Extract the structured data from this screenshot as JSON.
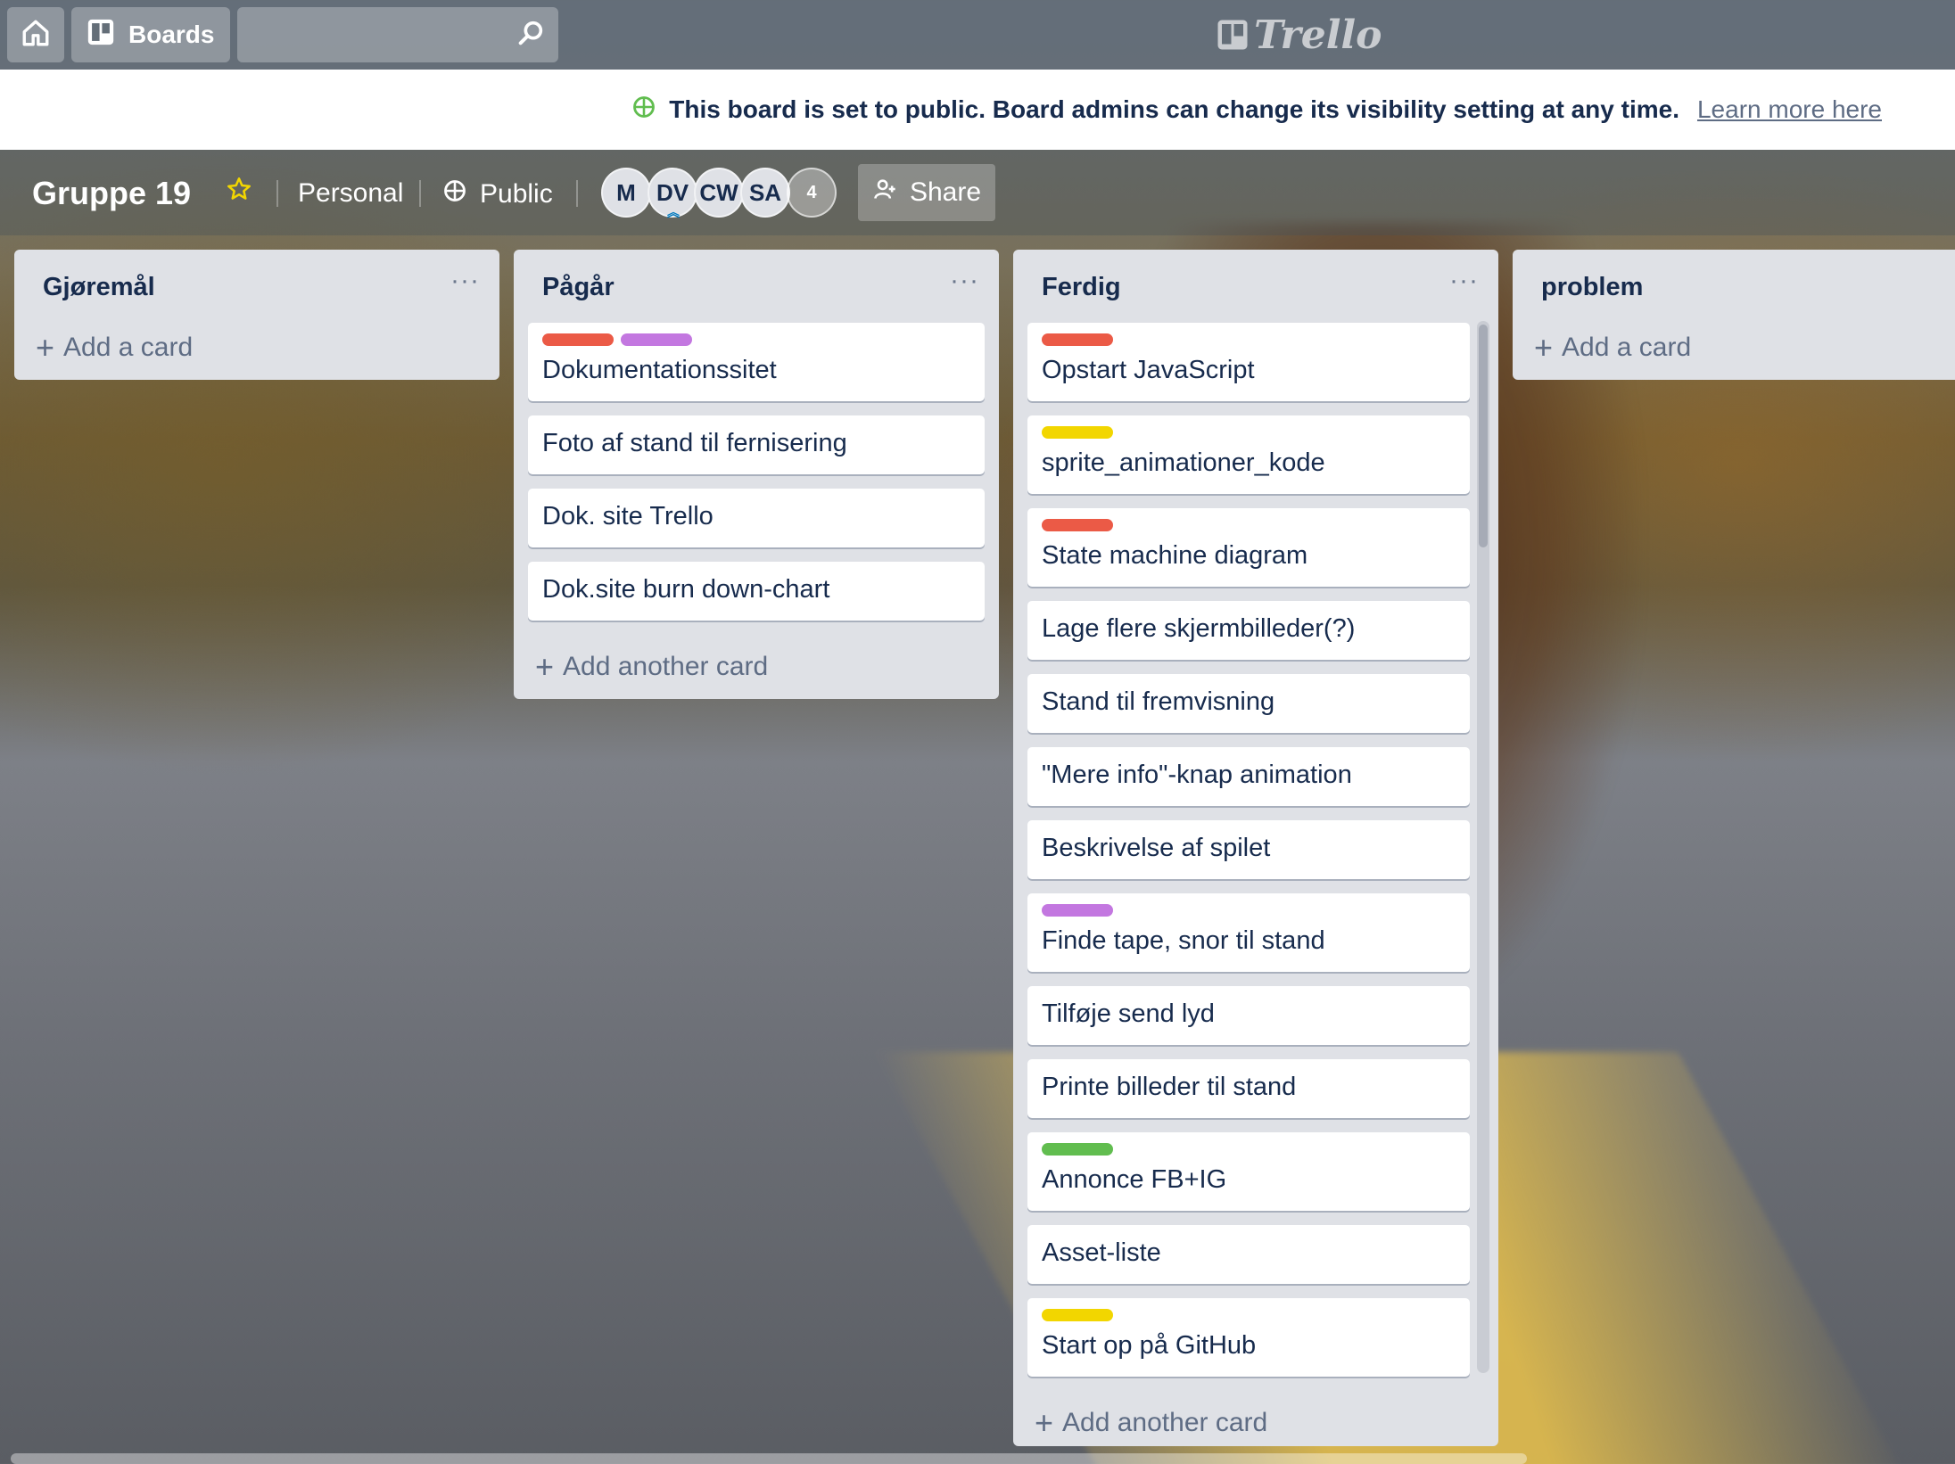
{
  "header": {
    "boards_label": "Boards",
    "logo_text": "Trello"
  },
  "notice": {
    "message": "This board is set to public. Board admins can change its visibility setting at any time.",
    "link": "Learn more here"
  },
  "board": {
    "title": "Gruppe 19",
    "team": "Personal",
    "visibility": "Public",
    "members": [
      "M",
      "DV",
      "CW",
      "SA"
    ],
    "member_count": "4",
    "share_label": "Share"
  },
  "label_colors": {
    "red": "#eb5a46",
    "purple": "#c377e0",
    "yellow": "#f2d600",
    "green": "#61bd4f"
  },
  "lists": [
    {
      "title": "Gjøremål",
      "menu": "···",
      "add_label": "Add a card",
      "cards": []
    },
    {
      "title": "Pågår",
      "menu": "···",
      "add_label": "Add another card",
      "cards": [
        {
          "title": "Dokumentationssitet",
          "labels": [
            "red",
            "purple"
          ]
        },
        {
          "title": "Foto af stand til fernisering",
          "labels": []
        },
        {
          "title": "Dok. site Trello",
          "labels": []
        },
        {
          "title": "Dok.site burn down-chart",
          "labels": []
        }
      ]
    },
    {
      "title": "Ferdig",
      "menu": "···",
      "add_label": "Add another card",
      "cards": [
        {
          "title": "Opstart JavaScript",
          "labels": [
            "red"
          ]
        },
        {
          "title": "sprite_animationer_kode",
          "labels": [
            "yellow"
          ]
        },
        {
          "title": "State machine diagram",
          "labels": [
            "red"
          ]
        },
        {
          "title": "Lage flere skjermbilleder(?)",
          "labels": []
        },
        {
          "title": "Stand til fremvisning",
          "labels": []
        },
        {
          "title": "\"Mere info\"-knap animation",
          "labels": []
        },
        {
          "title": "Beskrivelse af spilet",
          "labels": []
        },
        {
          "title": "Finde tape, snor til stand",
          "labels": [
            "purple"
          ]
        },
        {
          "title": "Tilføje send lyd",
          "labels": []
        },
        {
          "title": "Printe billeder til stand",
          "labels": []
        },
        {
          "title": "Annonce FB+IG",
          "labels": [
            "green"
          ]
        },
        {
          "title": "Asset-liste",
          "labels": []
        },
        {
          "title": "Start op på GitHub",
          "labels": [
            "yellow"
          ]
        }
      ]
    },
    {
      "title": "problem",
      "menu": "···",
      "add_label": "Add a card",
      "cards": []
    }
  ]
}
